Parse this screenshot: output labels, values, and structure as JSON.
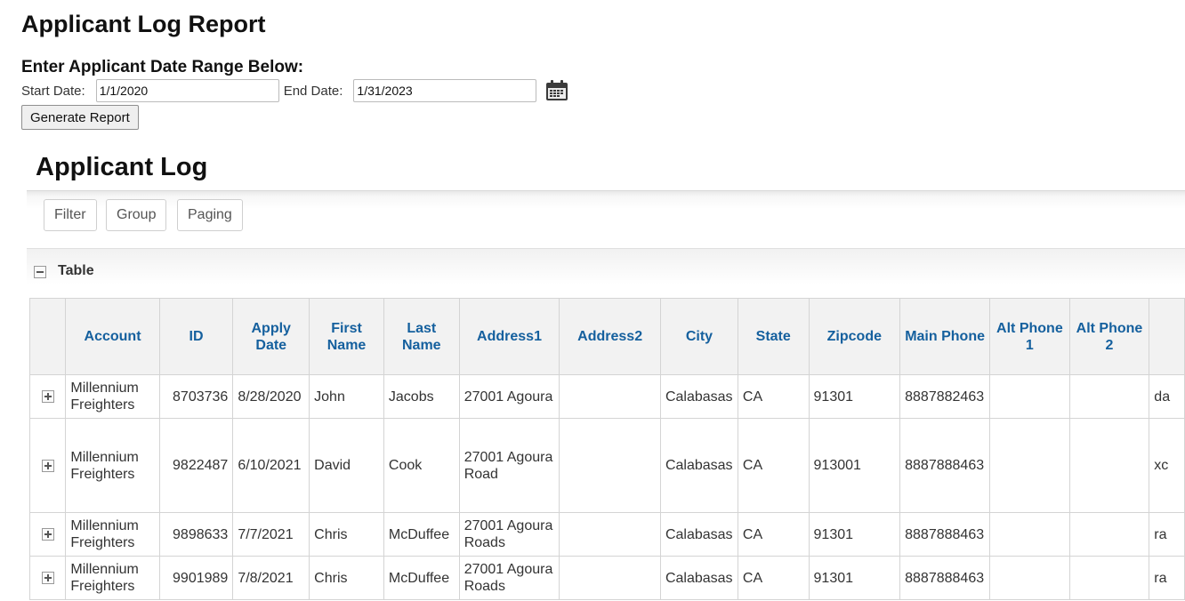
{
  "report": {
    "title": "Applicant Log Report",
    "range_label": "Enter Applicant Date Range Below:",
    "start_label": "Start Date:",
    "start_value": "1/1/2020",
    "end_label": "End Date:",
    "end_value": "1/31/2023",
    "generate_label": "Generate Report"
  },
  "log": {
    "title": "Applicant Log",
    "toolbar": {
      "filter": "Filter",
      "group": "Group",
      "paging": "Paging"
    },
    "section_label": "Table"
  },
  "grid": {
    "columns": [
      "Account",
      "ID",
      "Apply Date",
      "First Name",
      "Last Name",
      "Address1",
      "Address2",
      "City",
      "State",
      "Zipcode",
      "Main Phone",
      "Alt Phone 1",
      "Alt Phone 2",
      ""
    ],
    "rows": [
      [
        "Millennium Freighters",
        "8703736",
        "8/28/2020",
        "John",
        "Jacobs",
        "27001 Agoura",
        "",
        "Calabasas",
        "CA",
        "91301",
        "8887882463",
        "",
        "",
        "da"
      ],
      [
        "Millennium Freighters",
        "9822487",
        "6/10/2021",
        "David",
        "Cook",
        "27001 Agoura Road",
        "",
        "Calabasas",
        "CA",
        "913001",
        "8887888463",
        "",
        "",
        "xc"
      ],
      [
        "Millennium Freighters",
        "9898633",
        "7/7/2021",
        "Chris",
        "McDuffee",
        "27001 Agoura Roads",
        "",
        "Calabasas",
        "CA",
        "91301",
        "8887888463",
        "",
        "",
        "ra"
      ],
      [
        "Millennium Freighters",
        "9901989",
        "7/8/2021",
        "Chris",
        "McDuffee",
        "27001 Agoura Roads",
        "",
        "Calabasas",
        "CA",
        "91301",
        "8887888463",
        "",
        "",
        "ra"
      ]
    ]
  },
  "colors": {
    "header_text": "#15609e",
    "header_bg": "#f2f2f2",
    "border": "#d4d4d4"
  },
  "icons": {
    "calendar": "calendar-icon",
    "collapse": "collapse-minus-icon",
    "expand": "expand-plus-icon"
  }
}
